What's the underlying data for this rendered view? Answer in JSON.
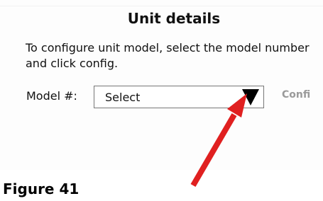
{
  "dialog": {
    "title": "Unit details",
    "instructions": "To configure unit model, select the model number and click config."
  },
  "form": {
    "model_label": "Model #:",
    "model_select_value": "Select",
    "config_label": "Confi"
  },
  "annotation": {
    "arrow_color": "#e02020"
  },
  "caption": "Figure 41",
  "icons": {
    "dropdown": "chevron-down-icon",
    "pointer": "red-arrow"
  }
}
